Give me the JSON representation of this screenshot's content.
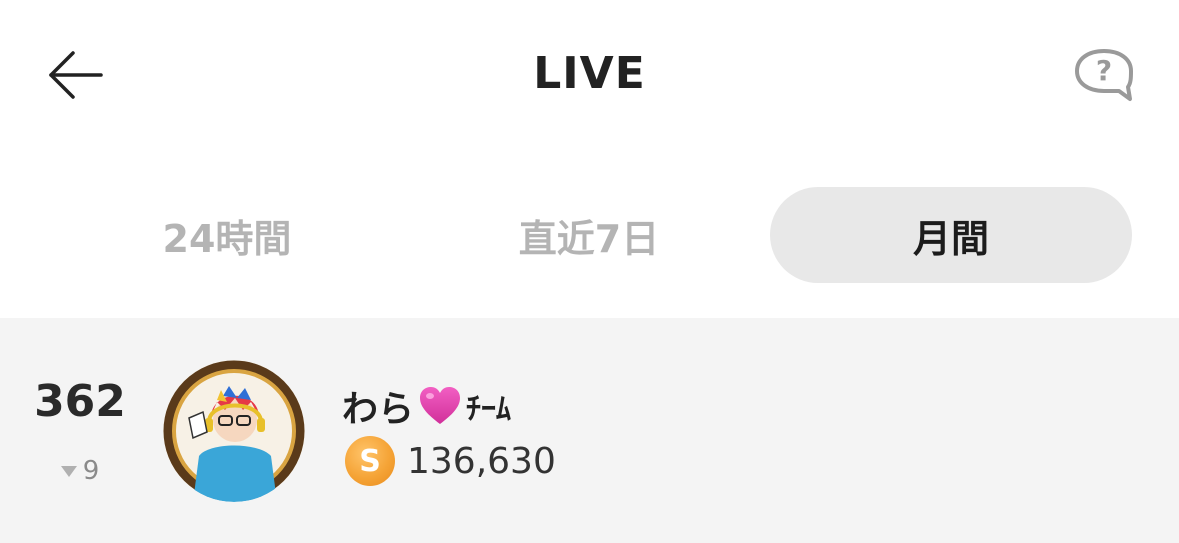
{
  "header": {
    "title": "LIVE",
    "back_icon": "arrow-left-icon",
    "help_icon": "question-bubble-icon"
  },
  "tabs": [
    {
      "label": "24時間",
      "active": false
    },
    {
      "label": "直近7日",
      "active": false
    },
    {
      "label": "月間",
      "active": true
    }
  ],
  "ranking": [
    {
      "rank": "362",
      "change_direction": "down",
      "change": "9",
      "name_prefix": "わら",
      "name_emoji": "heart-icon",
      "name_suffix": "ﾁｰﾑ",
      "coin_letter": "S",
      "points": "136,630"
    }
  ],
  "colors": {
    "active_tab_bg": "#e8e8e8",
    "inactive_tab_text": "#b4b4b4",
    "row_bg": "#f4f4f4",
    "coin": "#f5a437",
    "heart": "#e040a8"
  }
}
